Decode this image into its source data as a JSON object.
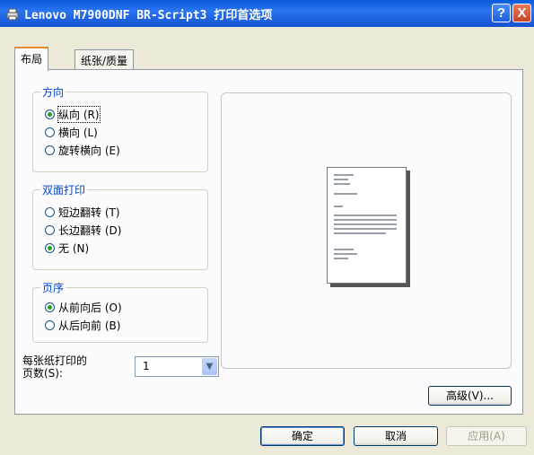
{
  "window": {
    "title": "Lenovo M7900DNF BR-Script3 打印首选项",
    "help_label": "?",
    "close_label": "X"
  },
  "tabs": [
    {
      "label": "布局",
      "active": true
    },
    {
      "label": "纸张/质量",
      "active": false
    }
  ],
  "orientation": {
    "legend": "方向",
    "options": [
      {
        "label": "纵向 (R)",
        "selected": true
      },
      {
        "label": "横向 (L)",
        "selected": false
      },
      {
        "label": "旋转横向 (E)",
        "selected": false
      }
    ]
  },
  "duplex": {
    "legend": "双面打印",
    "options": [
      {
        "label": "短边翻转 (T)",
        "selected": false
      },
      {
        "label": "长边翻转 (D)",
        "selected": false
      },
      {
        "label": "无 (N)",
        "selected": true
      }
    ]
  },
  "page_order": {
    "legend": "页序",
    "options": [
      {
        "label": "从前向后 (O)",
        "selected": true
      },
      {
        "label": "从后向前 (B)",
        "selected": false
      }
    ]
  },
  "pages_per_sheet": {
    "label_line1": "每张纸打印的",
    "label_line2": "页数(S):",
    "value": "1"
  },
  "buttons": {
    "advanced": "高级(V)...",
    "ok": "确定",
    "cancel": "取消",
    "apply": "应用(A)"
  }
}
